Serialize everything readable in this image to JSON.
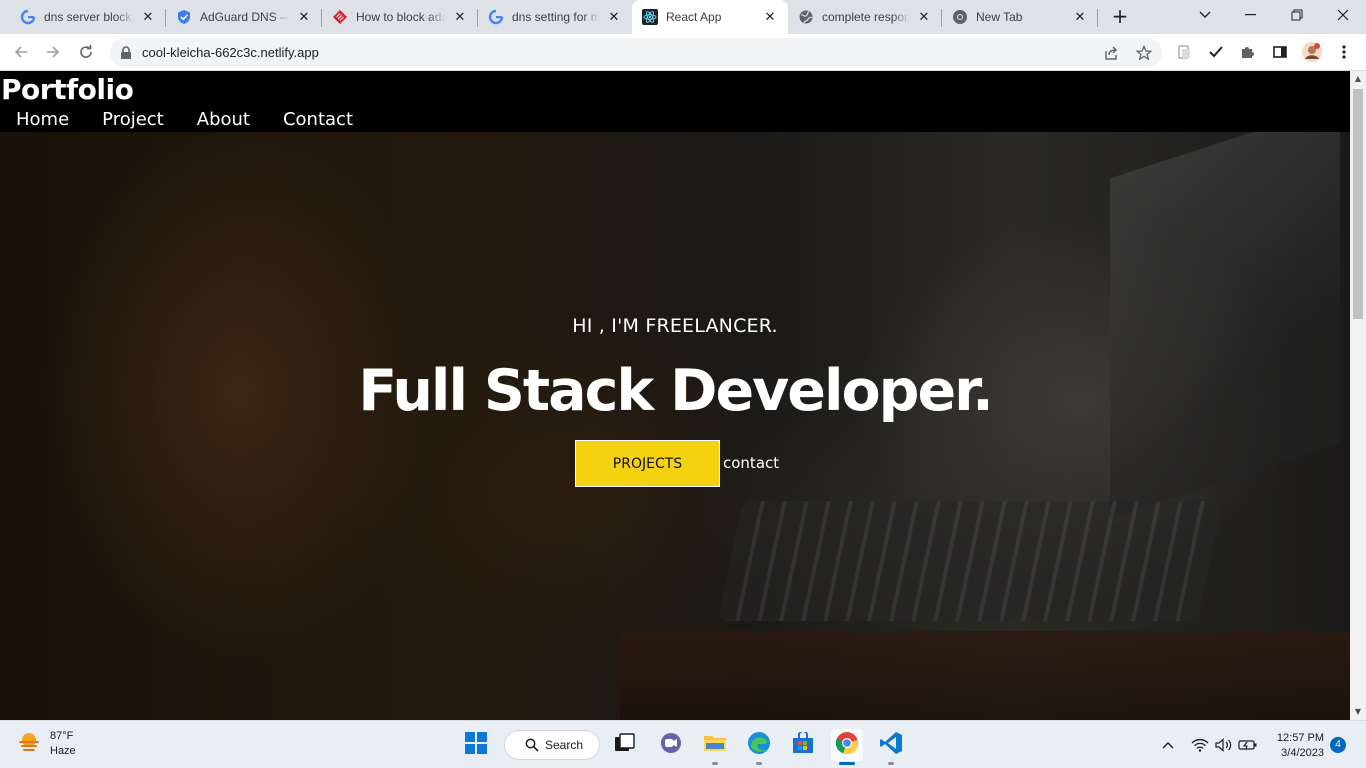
{
  "browser": {
    "tabs": [
      {
        "title": "dns server block f",
        "favicon": "google-icon",
        "active": false
      },
      {
        "title": "AdGuard DNS —",
        "favicon": "adguard-icon",
        "active": false
      },
      {
        "title": "How to block ads",
        "favicon": "red-diamond-icon",
        "active": false
      },
      {
        "title": "dns setting for m",
        "favicon": "google-icon",
        "active": false
      },
      {
        "title": "React App",
        "favicon": "react-icon",
        "active": true
      },
      {
        "title": "complete respon",
        "favicon": "globe-icon",
        "active": false
      },
      {
        "title": "New Tab",
        "favicon": "chrome-icon",
        "active": false
      }
    ],
    "close_glyph": "✕",
    "new_tab_glyph": "+",
    "url": "cool-kleicha-662c3c.netlify.app"
  },
  "site": {
    "logo": "Portfolio",
    "nav": [
      "Home",
      "Project",
      "About",
      "Contact"
    ],
    "hero": {
      "subtitle": "HI , I'M FREELANCER.",
      "title": "Full Stack Developer.",
      "primary_button": "PROJECTS",
      "secondary_link": "contact"
    },
    "accent_color": "#f5d20f"
  },
  "taskbar": {
    "weather": {
      "temp": "87°F",
      "condition": "Haze"
    },
    "search_label": "Search",
    "clock": {
      "time": "12:57 PM",
      "date": "3/4/2023"
    },
    "notification_count": "4"
  }
}
